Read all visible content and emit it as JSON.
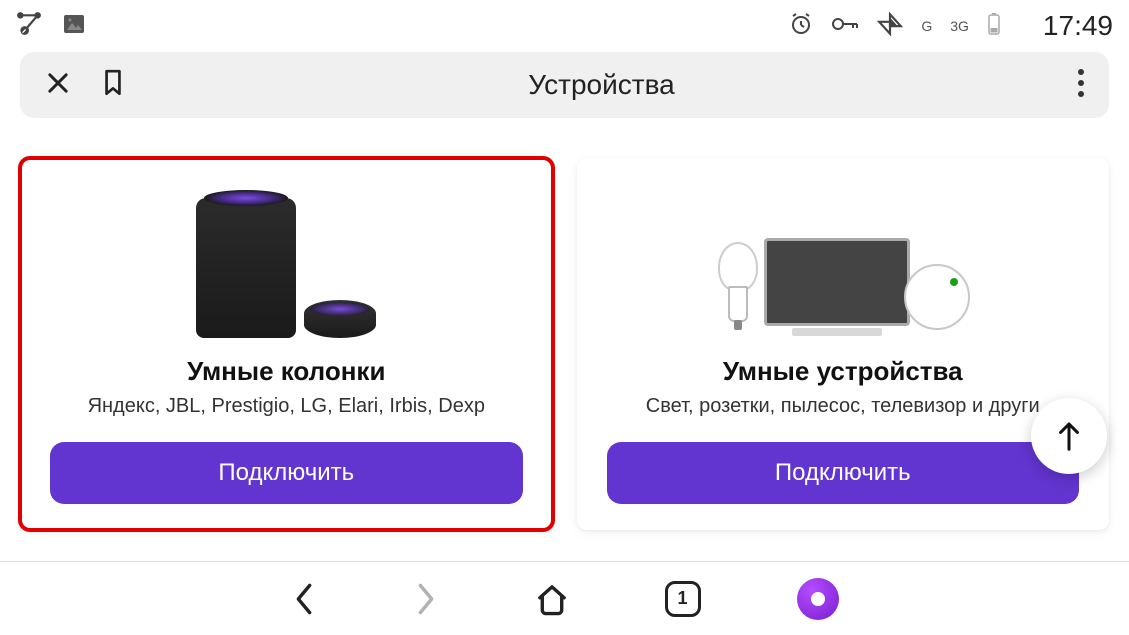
{
  "statusbar": {
    "net1": "G",
    "net2": "3G",
    "time": "17:49"
  },
  "appbar": {
    "title": "Устройства"
  },
  "cards": [
    {
      "title": "Умные колонки",
      "subtitle": "Яндекс, JBL, Prestigio, LG, Elari, Irbis, Dexp",
      "button": "Подключить",
      "highlighted": true
    },
    {
      "title": "Умные устройства",
      "subtitle": "Свет, розетки, пылесос, телевизор и други",
      "button": "Подключить",
      "highlighted": false
    }
  ],
  "bottomnav": {
    "tab_count": "1"
  }
}
